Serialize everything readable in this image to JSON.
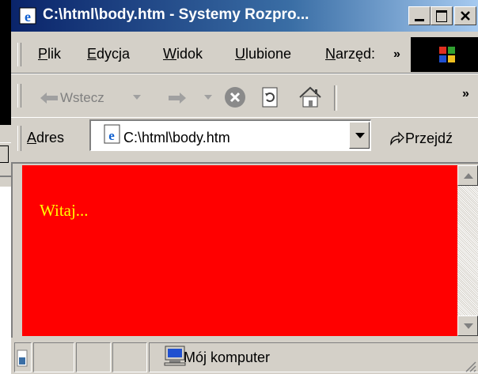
{
  "window": {
    "title": "C:\\html\\body.htm - Systemy Rozpro...",
    "controls": [
      "minimize",
      "maximize",
      "close"
    ]
  },
  "menubar": {
    "items": [
      {
        "label": "Plik",
        "key": "P"
      },
      {
        "label": "Edycja",
        "key": "E"
      },
      {
        "label": "Widok",
        "key": "W"
      },
      {
        "label": "Ulubione",
        "key": "U"
      },
      {
        "label": "Narzęd:",
        "key": "N"
      }
    ],
    "more": "»"
  },
  "toolbar": {
    "back_label": "Wstecz",
    "more": "»",
    "icons": [
      "back-arrow-icon",
      "forward-arrow-icon",
      "stop-icon",
      "refresh-icon",
      "home-icon"
    ]
  },
  "addressbar": {
    "label": "Adres",
    "value": "C:\\html\\body.htm",
    "go_label": "Przejdź"
  },
  "page": {
    "background": "#ff0000",
    "text_color": "#ffff00",
    "greeting": "Witaj..."
  },
  "statusbar": {
    "zone": "Mój komputer"
  }
}
